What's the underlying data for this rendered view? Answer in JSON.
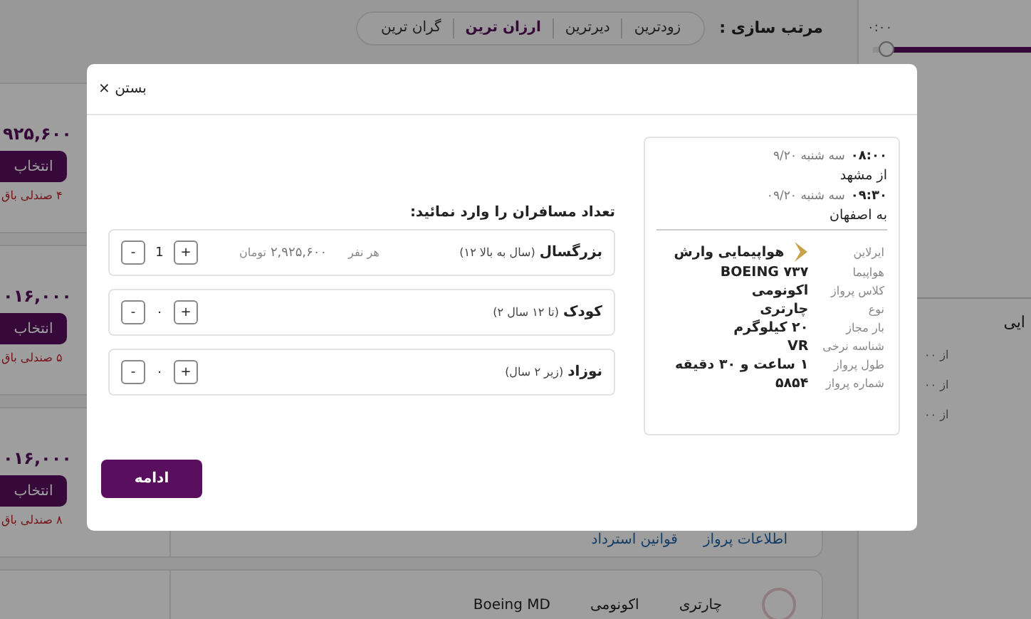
{
  "sort_bar": {
    "label": "مرتب سازی :",
    "options": [
      {
        "label": "زودترین",
        "selected": false
      },
      {
        "label": "دیرترین",
        "selected": false
      },
      {
        "label": "ارزان ترین",
        "selected": true
      },
      {
        "label": "گران ترین",
        "selected": false
      }
    ]
  },
  "results": [
    {
      "price": "۹۲۵,۶۰۰",
      "select_button": "انتخاب",
      "seats_left": "۴ صندلی باق"
    },
    {
      "price": "۰۱۶,۰۰۰",
      "select_button": "انتخاب",
      "seats_left": "۵ صندلی باق"
    },
    {
      "price": "۰۱۶,۰۰۰",
      "select_button": "انتخاب",
      "seats_left": "۸ صندلی باق",
      "links": [
        "اطلاعات پرواز",
        "قوانین استرداد"
      ]
    }
  ],
  "partial_card": {
    "texts": [
      "چارتری",
      "اکونومی",
      "Boeing MD"
    ]
  },
  "time_filter": {
    "label": "۰:۰۰",
    "level": 0.92
  },
  "airline_filter": {
    "title": "ایی",
    "items": [
      "از ۰۰",
      "از ۰۰",
      "از ۰۰"
    ]
  },
  "modal": {
    "close_button": "× بستن",
    "passengers_title": "تعداد مسافران را وارد نمائید:",
    "passengers": [
      {
        "name": "بزرگسال",
        "age": "(سال به بالا ۱۲)",
        "price_label": "هر نفر",
        "price": "۲,۹۲۵,۶۰۰",
        "currency": "تومان",
        "count": "1",
        "increment": "+",
        "decrement": "-"
      },
      {
        "name": "کودک",
        "age": "(تا ۱۲ سال ۲)",
        "count": "۰",
        "increment": "+",
        "decrement": "-"
      },
      {
        "name": "نوزاد",
        "age": "(زیر ۲ سال)",
        "count": "۰",
        "increment": "+",
        "decrement": "-"
      }
    ],
    "flight": {
      "departure": {
        "time": "۰۸:۰۰",
        "date": "سه شنبه ۹/۲۰",
        "city": "از مشهد"
      },
      "arrival": {
        "time": "۰۹:۳۰",
        "date": "سه شنبه ۰۹/۲۰",
        "city": "به اصفهان"
      },
      "details": [
        {
          "label": "ایرلاین",
          "value": "هواپیمایی وارش",
          "kind": "airline"
        },
        {
          "label": "هواپیما",
          "value": "BOEING ۷۳۷",
          "kind": "text"
        },
        {
          "label": "کلاس پرواز",
          "value": "اکونومی",
          "kind": "text"
        },
        {
          "label": "نوع",
          "value": "چارتری",
          "kind": "text"
        },
        {
          "label": "بار مجاز",
          "value": "۲۰ کیلوگرم",
          "kind": "text"
        },
        {
          "label": "شناسه نرخی",
          "value": "VR",
          "kind": "text"
        },
        {
          "label": "طول پرواز",
          "value": "۱ ساعت و ۳۰ دقیقه",
          "kind": "text"
        },
        {
          "label": "شماره پرواز",
          "value": "۵۸۵۴",
          "kind": "text"
        }
      ]
    },
    "continue_button": "ادامه"
  }
}
